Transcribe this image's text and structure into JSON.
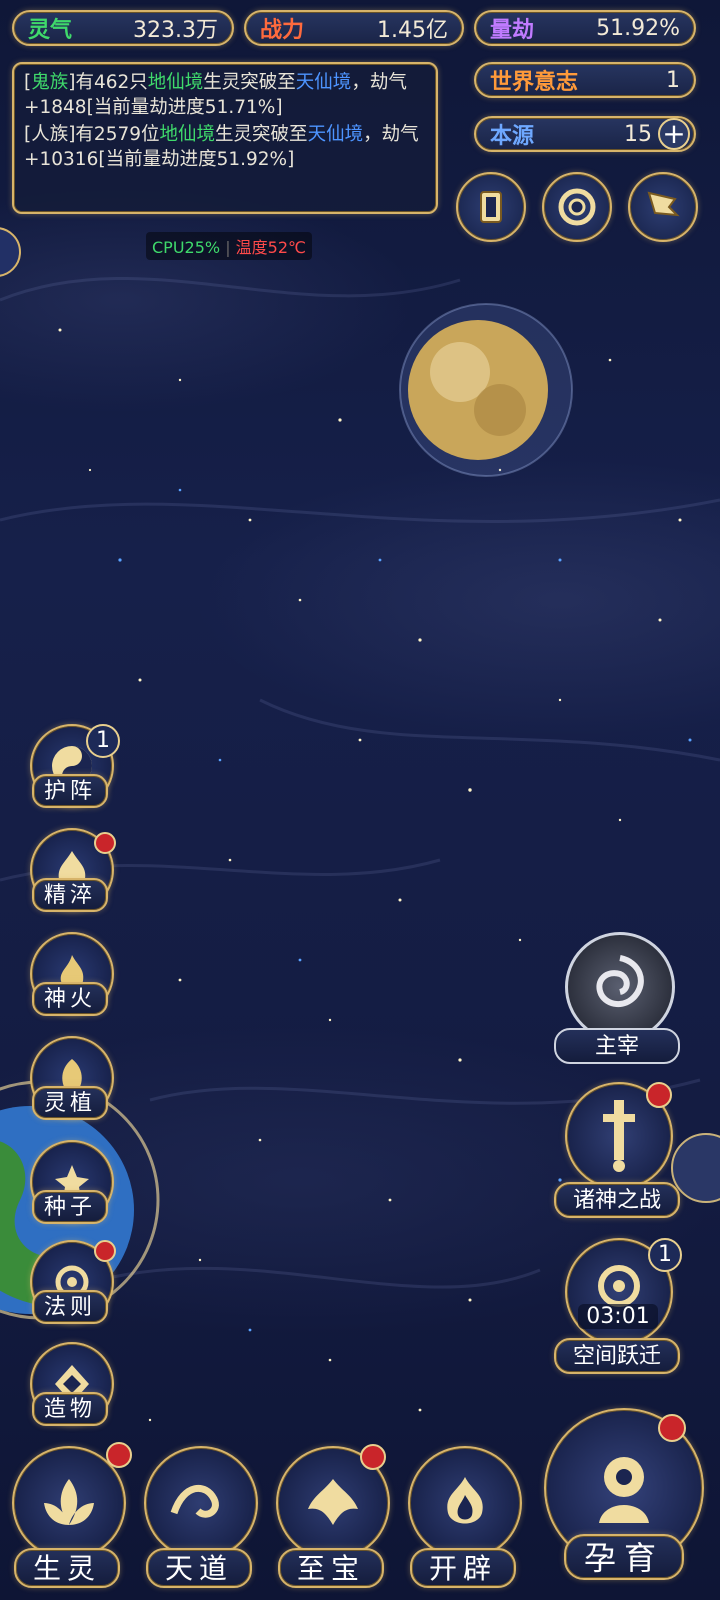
{
  "stats": {
    "lingqi": {
      "label": "灵气",
      "value": "323.3万",
      "color": "#3fd96b"
    },
    "zhanli": {
      "label": "战力",
      "value": "1.45亿",
      "color": "#ff6a3d"
    },
    "liangjie": {
      "label": "量劫",
      "value": "51.92%",
      "color": "#c07bff"
    },
    "world_will": {
      "label": "世界意志",
      "value": "1",
      "color": "#ff9a3a"
    },
    "benyuan": {
      "label": "本源",
      "value": "15",
      "color": "#6ea8ff",
      "plus": "+"
    }
  },
  "log": {
    "msg1": {
      "t1": "[",
      "race": "鬼族",
      "t2": "]有462只",
      "realm1": "地仙境",
      "t3": "生灵突破至",
      "realm2": "天仙境",
      "t4": "，劫气+1848[当前量劫进度51.71%]"
    },
    "msg2": {
      "t1": "[人族]有2579位",
      "realm1": "地仙境",
      "t3": "生灵突破至",
      "realm2": "天仙境",
      "t4": "，劫气+10316[当前量劫进度51.92%]"
    }
  },
  "perf": {
    "cpu": "CPU25%",
    "sep": "|",
    "temp": "温度52℃",
    "cpu_color": "#3fd96b",
    "temp_color": "#ff4a4a"
  },
  "top_icons": [
    {
      "name": "card-icon"
    },
    {
      "name": "vortex-icon"
    },
    {
      "name": "flag-icon"
    }
  ],
  "left_menu": [
    {
      "label": "护阵",
      "badge": "1",
      "icon": "taiji-icon"
    },
    {
      "label": "精淬",
      "icon": "flame-lotus-icon"
    },
    {
      "label": "神火",
      "icon": "fire-icon"
    },
    {
      "label": "灵植",
      "icon": "leaf-icon"
    },
    {
      "label": "种子",
      "icon": "seed-icon"
    },
    {
      "label": "法则",
      "icon": "dragon-icon"
    },
    {
      "label": "造物",
      "icon": "crystal-icon"
    }
  ],
  "right_menu": [
    {
      "label": "主宰",
      "icon": "dragon-emblem-icon"
    },
    {
      "label": "诸神之战",
      "icon": "sword-icon"
    },
    {
      "label": "空间跃迁",
      "badge": "1",
      "timer": "03:01",
      "icon": "portal-icon"
    }
  ],
  "bottom_nav": [
    {
      "label": "生灵",
      "icon": "lotus-icon"
    },
    {
      "label": "天道",
      "icon": "wave-icon"
    },
    {
      "label": "至宝",
      "icon": "phoenix-icon"
    },
    {
      "label": "开辟",
      "icon": "flame-icon"
    },
    {
      "label": "孕育",
      "icon": "womb-icon"
    }
  ]
}
